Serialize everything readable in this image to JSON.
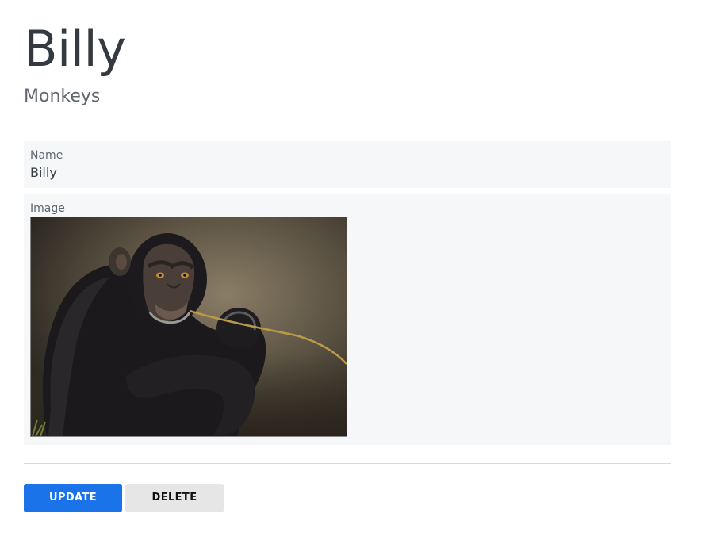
{
  "header": {
    "title": "Billy",
    "subtitle": "Monkeys"
  },
  "fields": {
    "name": {
      "label": "Name",
      "value": "Billy"
    },
    "image": {
      "label": "Image",
      "subject": "chimpanzee holding a stick"
    }
  },
  "actions": {
    "update_label": "UPDATE",
    "delete_label": "DELETE"
  },
  "colors": {
    "primary": "#1a73e8",
    "secondary": "#e6e6e6",
    "field_background": "#f6f7f9"
  }
}
